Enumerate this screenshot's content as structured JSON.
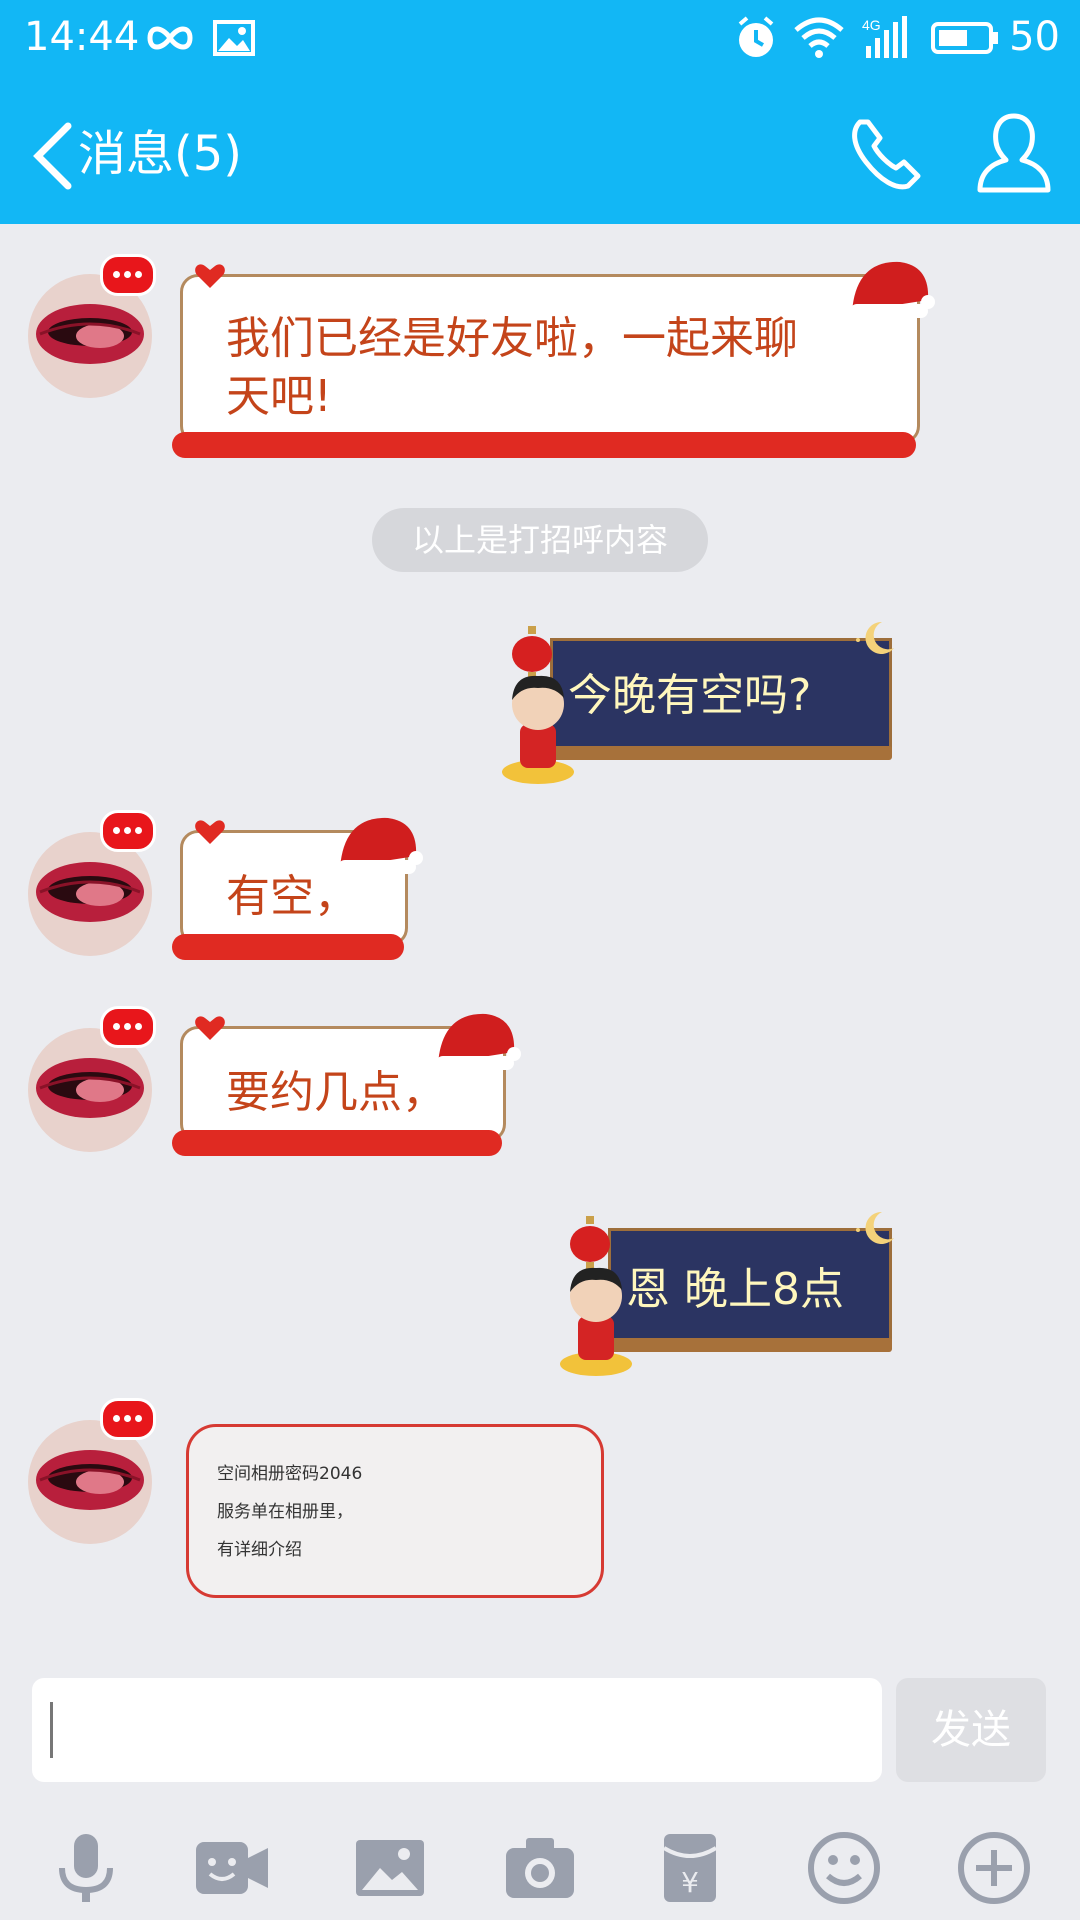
{
  "status_bar": {
    "time": "14:44",
    "battery": "50"
  },
  "header": {
    "title": "消息(5)"
  },
  "messages": [
    {
      "side": "left",
      "text_line1": "我们已经是好友啦，一起来聊",
      "text_line2": "天吧!"
    },
    {
      "side": "right",
      "text": "今晚有空吗?"
    },
    {
      "side": "left",
      "text": "有空，"
    },
    {
      "side": "left",
      "text": "要约几点，"
    },
    {
      "side": "right",
      "text": "恩 晚上8点"
    },
    {
      "side": "left",
      "lines": [
        "空间相册密码2046",
        "服务单在相册里，",
        "有详细介绍"
      ]
    }
  ],
  "system_notice": "以上是打招呼内容",
  "composer": {
    "input_value": "",
    "send_label": "发送"
  },
  "toolbar": {
    "icons": [
      "microphone-icon",
      "video-icon",
      "image-icon",
      "camera-icon",
      "red-packet-icon",
      "emoji-icon",
      "plus-icon"
    ]
  },
  "colors": {
    "header_bg": "#12b7f5",
    "chat_bg": "#ebecf0",
    "left_text": "#c4441a",
    "right_bubble": "#2b3462",
    "right_text": "#fff7bd"
  }
}
